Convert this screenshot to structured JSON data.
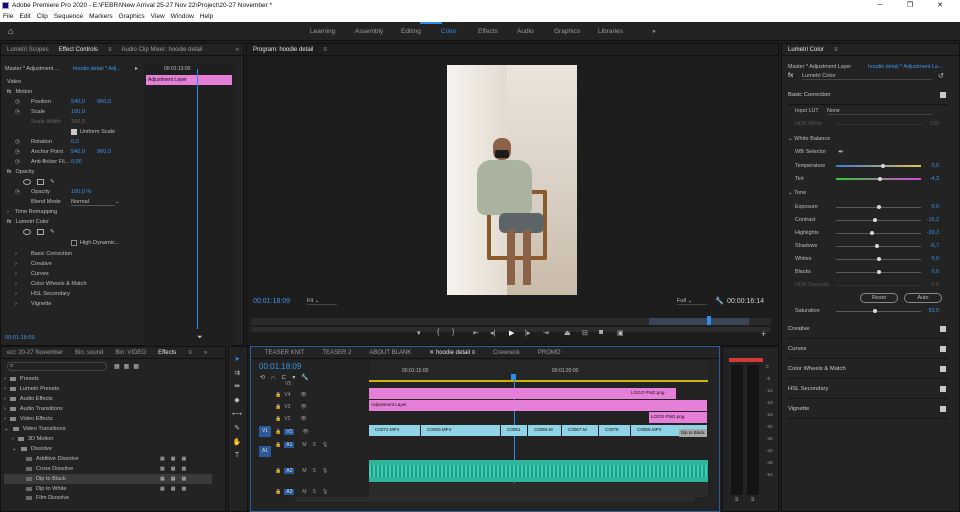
{
  "window": {
    "title": "Adobe Premiere Pro 2020 - E:\\FEBRI\\New Arrival 25-27 Nov 22\\Project\\20-27 November *",
    "minimize": "─",
    "maximize": "❐",
    "close": "✕"
  },
  "menu": [
    "File",
    "Edit",
    "Clip",
    "Sequence",
    "Markers",
    "Graphics",
    "View",
    "Window",
    "Help"
  ],
  "workspaces": {
    "items": [
      "Learning",
      "Assembly",
      "Editing",
      "Color",
      "Effects",
      "Audio",
      "Graphics",
      "Libraries"
    ],
    "active": "Color",
    "more": "»"
  },
  "left_tabs": {
    "lumetri_scopes": "Lumetri Scopes",
    "effect_controls": "Effect Controls",
    "audio_mixer": "Audio Clip Mixer: hoodie detail"
  },
  "effect_controls": {
    "master": "Master * Adjustment ...",
    "clip": "hoodie detail * Adj...",
    "timecode_head": "00:01:13:00",
    "clip_bar": "Adjustment Layer",
    "section_video": "Video",
    "motion": "Motion",
    "position": {
      "label": "Position",
      "x": "540,0",
      "y": "960,0"
    },
    "scale": {
      "label": "Scale",
      "v": "100,0"
    },
    "scale_width": {
      "label": "Scale Width",
      "v": "100,0"
    },
    "uniform": "Uniform Scale",
    "rotation": {
      "label": "Rotation",
      "v": "0,0"
    },
    "anchor": {
      "label": "Anchor Point",
      "x": "540,0",
      "y": "960,0"
    },
    "antiflicker": {
      "label": "Anti-flicker Fil...",
      "v": "0,00"
    },
    "opacity_section": "Opacity",
    "opacity": {
      "label": "Opacity",
      "v": "100,0 %"
    },
    "blend": {
      "label": "Blend Mode",
      "v": "Normal"
    },
    "time_remap": "Time Remapping",
    "lumetri": "Lumetri Color",
    "high_dynamic": "High Dynamic...",
    "lumetri_items": [
      "Basic Correction",
      "Creative",
      "Curves",
      "Color Wheels & Match",
      "HSL Secondary",
      "Vignette"
    ],
    "timecode": "00:01:18:09"
  },
  "program": {
    "title": "Program: hoodie detail",
    "timecode": "00:01:18:09",
    "fit": "Fit",
    "quality": "Full",
    "duration": "00:00:16:14"
  },
  "lumetri": {
    "title": "Lumetri Color",
    "master": "Master * Adjustment Layer",
    "clip": "hoodie detail * Adjustment La...",
    "effect": "Lumetri Color",
    "basic": "Basic Correction",
    "input_lut": {
      "label": "Input LUT",
      "v": "None"
    },
    "hdr_white": {
      "label": "HDR White",
      "v": "100"
    },
    "wb": "White Balance",
    "wb_selector": "WB Selector",
    "temperature": {
      "label": "Temperature",
      "v": "0,0",
      "pos": 0.55
    },
    "tint": {
      "label": "Tint",
      "v": "-4,3",
      "pos": 0.52
    },
    "tone": "Tone",
    "exposure": {
      "label": "Exposure",
      "v": "0,0",
      "pos": 0.5
    },
    "contrast": {
      "label": "Contrast",
      "v": "-15,2",
      "pos": 0.46
    },
    "highlights": {
      "label": "Highlights",
      "v": "-29,3",
      "pos": 0.42
    },
    "shadows": {
      "label": "Shadows",
      "v": "-6,7",
      "pos": 0.48
    },
    "whites": {
      "label": "Whites",
      "v": "0,0",
      "pos": 0.5
    },
    "blacks": {
      "label": "Blacks",
      "v": "0,0",
      "pos": 0.5
    },
    "hdr_specular": {
      "label": "HDR Specular",
      "v": "0,0"
    },
    "reset": "Reset",
    "auto": "Auto",
    "saturation": {
      "label": "Saturation",
      "v": "93,5",
      "pos": 0.46
    },
    "sections": [
      "Creative",
      "Curves",
      "Color Wheels & Match",
      "HSL Secondary",
      "Vignette"
    ]
  },
  "project": {
    "tabs": [
      "ect: 20-27 November",
      "Bin: sound",
      "Bin: VIDEO",
      "Effects"
    ],
    "items": [
      "Presets",
      "Lumetri Presets",
      "Audio Effects",
      "Audio Transitions",
      "Video Effects",
      "Video Transitions",
      "3D Motion",
      "Dissolve",
      "Additive Dissolve",
      "Cross Dissolve",
      "Dip to Black",
      "Dip to White",
      "Film Dissolve"
    ]
  },
  "timeline": {
    "tabs": [
      "TEASER KNIT",
      "TEASER 2",
      "ABOUT BLANK",
      "hoodie detail",
      "Crewneck",
      "PROMO"
    ],
    "active": "hoodie detail",
    "timecode": "00:01:18:09",
    "ruler": [
      "00:01:15:00",
      "00:01:20:00"
    ],
    "tracks": [
      "V5",
      "V4",
      "V3",
      "V2",
      "V1",
      "A1",
      "A2",
      "A3"
    ],
    "clips": {
      "logo1": "LOGO PNG.png",
      "adj": "Adjustment Layer",
      "logo2": "LOGO PNG.png",
      "v1": [
        "C0072.MP4",
        "C0060.MP4",
        "C0051",
        "C0059.M",
        "C0067.M",
        "C0078",
        "C0055.MP4"
      ],
      "dip": "Dip to Black"
    }
  },
  "meters": [
    "0",
    "-6",
    "-12",
    "-18",
    "-24",
    "-30",
    "-36",
    "-42",
    "-48",
    "-54"
  ],
  "meter_solo": [
    "S",
    "S"
  ],
  "colors": {
    "accent": "#2d8ceb",
    "pink": "#e67fd8",
    "v1": "#8fd3e6",
    "audio": "#2fb59c",
    "playhead": "#2d8ceb"
  }
}
